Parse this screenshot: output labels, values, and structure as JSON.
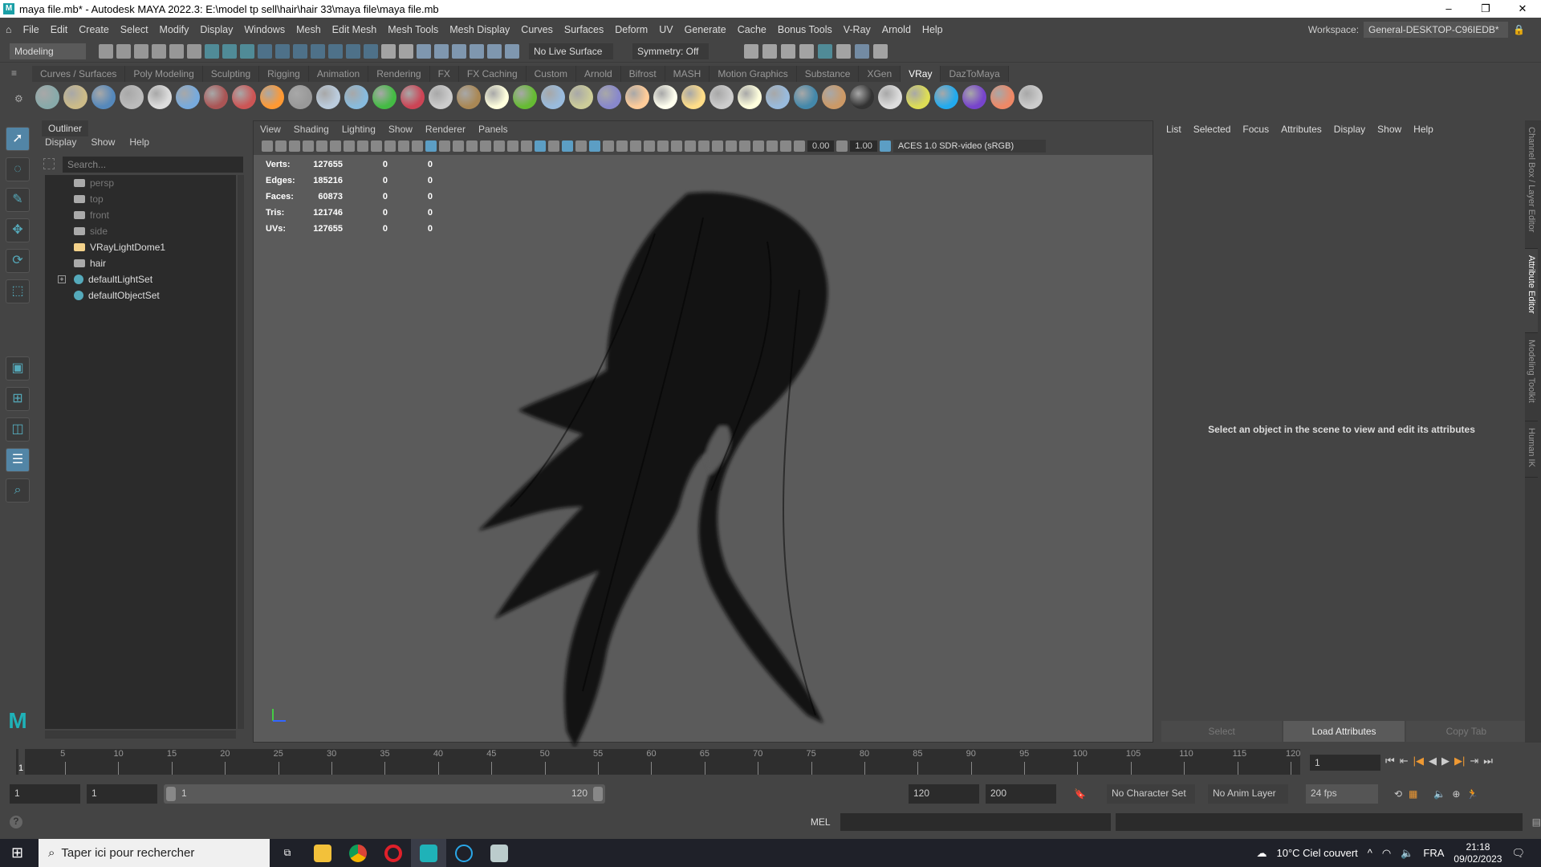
{
  "title": "maya file.mb* - Autodesk MAYA 2022.3: E:\\model tp sell\\hair\\hair 33\\maya file\\maya file.mb",
  "menus": [
    "File",
    "Edit",
    "Create",
    "Select",
    "Modify",
    "Display",
    "Windows",
    "Mesh",
    "Edit Mesh",
    "Mesh Tools",
    "Mesh Display",
    "Curves",
    "Surfaces",
    "Deform",
    "UV",
    "Generate",
    "Cache",
    "Bonus Tools",
    "V-Ray",
    "Arnold",
    "Help"
  ],
  "workspace": {
    "label": "Workspace:",
    "value": "General-DESKTOP-C96IEDB*"
  },
  "statusline": {
    "menuset": "Modeling",
    "live_surface": "No Live Surface",
    "symmetry": "Symmetry: Off"
  },
  "shelf_tabs": [
    "Curves / Surfaces",
    "Poly Modeling",
    "Sculpting",
    "Rigging",
    "Animation",
    "Rendering",
    "FX",
    "FX Caching",
    "Custom",
    "Arnold",
    "Bifrost",
    "MASH",
    "Motion Graphics",
    "Substance",
    "XGen",
    "VRay",
    "DazToMaya"
  ],
  "shelf_active": "VRay",
  "shelf_icon_colors": [
    "#8aa",
    "#cb8",
    "#58b",
    "#bbb",
    "#ddd",
    "#7ad",
    "#a55",
    "#c55",
    "#f93",
    "#999",
    "#bcd",
    "#8bd",
    "#4b4",
    "#c45",
    "#ccc",
    "#a85",
    "#ffd",
    "#6b3",
    "#9bd",
    "#cc9",
    "#88c",
    "#fc9",
    "#ffe",
    "#fd8",
    "#ccc",
    "#ffd",
    "#9bd",
    "#48a",
    "#c96",
    "#333",
    "#ddd",
    "#dd5",
    "#2ae",
    "#74c",
    "#e86",
    "#ccc"
  ],
  "outliner": {
    "title": "Outliner",
    "menu": [
      "Display",
      "Show",
      "Help"
    ],
    "search_placeholder": "Search...",
    "items": [
      {
        "label": "persp",
        "dim": true
      },
      {
        "label": "top",
        "dim": true
      },
      {
        "label": "front",
        "dim": true
      },
      {
        "label": "side",
        "dim": true
      },
      {
        "label": "VRayLightDome1"
      },
      {
        "label": "hair"
      },
      {
        "label": "defaultLightSet",
        "expandable": true
      },
      {
        "label": "defaultObjectSet"
      }
    ]
  },
  "viewport": {
    "menu": [
      "View",
      "Shading",
      "Lighting",
      "Show",
      "Renderer",
      "Panels"
    ],
    "exposure": "0.00",
    "gamma": "1.00",
    "color_space": "ACES 1.0 SDR-video (sRGB)",
    "hud": [
      [
        "Verts:",
        "127655",
        "0",
        "0"
      ],
      [
        "Edges:",
        "185216",
        "0",
        "0"
      ],
      [
        "Faces:",
        "60873",
        "0",
        "0"
      ],
      [
        "Tris:",
        "121746",
        "0",
        "0"
      ],
      [
        "UVs:",
        "127655",
        "0",
        "0"
      ]
    ]
  },
  "attribute_editor": {
    "menu": [
      "List",
      "Selected",
      "Focus",
      "Attributes",
      "Display",
      "Show",
      "Help"
    ],
    "message": "Select an object in the scene to view and edit its attributes",
    "buttons": [
      "Select",
      "Load Attributes",
      "Copy Tab"
    ]
  },
  "side_tabs": [
    "Channel Box / Layer Editor",
    "Attribute Editor",
    "Modeling Toolkit",
    "Human IK"
  ],
  "timeline": {
    "ticks": [
      5,
      10,
      15,
      20,
      25,
      30,
      35,
      40,
      45,
      50,
      55,
      60,
      65,
      70,
      75,
      80,
      85,
      90,
      95,
      100,
      105,
      110,
      115,
      120
    ],
    "current": "1",
    "current_frame": "1"
  },
  "range": {
    "start": "1",
    "anim_start": "1",
    "range_start": "1",
    "range_end": "120",
    "end": "120",
    "anim_end": "200",
    "character_set": "No Character Set",
    "anim_layer": "No Anim Layer",
    "fps": "24 fps"
  },
  "cmdline": {
    "label": "MEL"
  },
  "taskbar": {
    "search": "Taper ici pour rechercher",
    "weather": "10°C  Ciel couvert",
    "lang": "FRA",
    "time": "21:18",
    "date": "09/02/2023"
  }
}
